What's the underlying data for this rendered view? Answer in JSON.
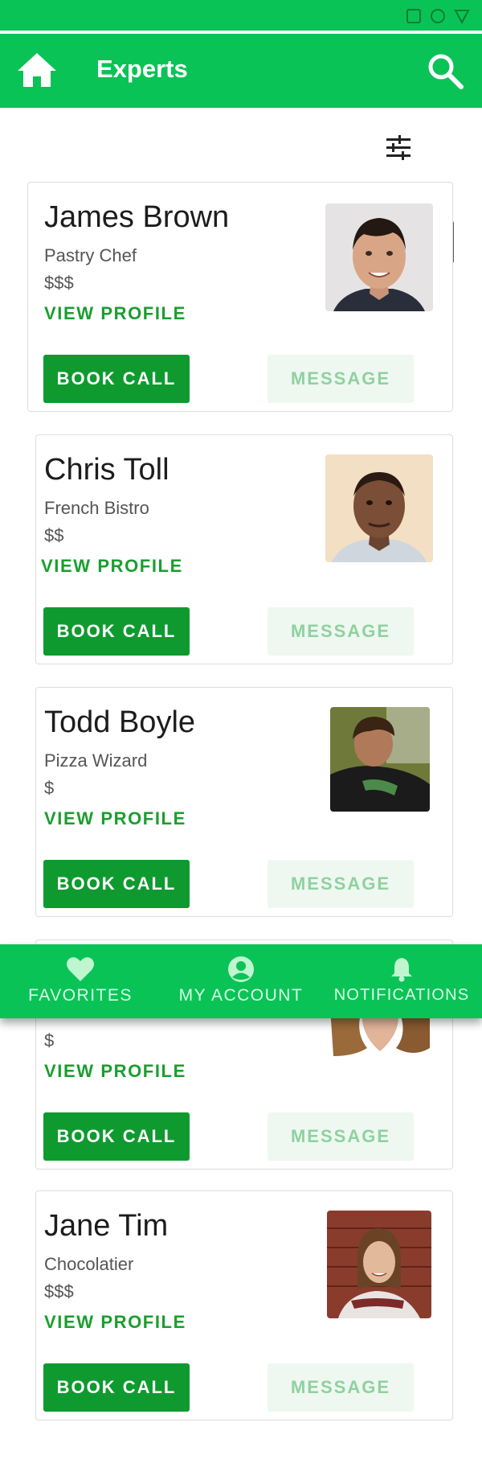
{
  "header": {
    "title": "Experts"
  },
  "icons": {
    "home": "home-icon",
    "search": "search-icon",
    "filter": "filter-sliders-icon",
    "favorites": "heart-icon",
    "account": "account-circle-icon",
    "notifications": "bell-icon"
  },
  "colors": {
    "brand_green": "#0ac356",
    "button_green": "#0f9a2f",
    "link_green": "#1a9e2e",
    "message_bg": "#eef8f0",
    "message_text": "#8fd1a0"
  },
  "experts": [
    {
      "name": "James Brown",
      "role": "Pastry Chef",
      "price": "$$$",
      "view_profile": "VIEW PROFILE",
      "book_call": "BOOK CALL",
      "message": "MESSAGE"
    },
    {
      "name": "Chris Toll",
      "role": "French Bistro",
      "price": "$$",
      "view_profile": "VIEW PROFILE",
      "book_call": "BOOK CALL",
      "message": "MESSAGE"
    },
    {
      "name": "Todd Boyle",
      "role": "Pizza Wizard",
      "price": "$",
      "view_profile": "VIEW PROFILE",
      "book_call": "BOOK CALL",
      "message": "MESSAGE"
    },
    {
      "price": "$",
      "view_profile": "VIEW PROFILE",
      "book_call": "BOOK CALL",
      "message": "MESSAGE"
    },
    {
      "name": "Jane Tim",
      "role": "Chocolatier",
      "price": "$$$",
      "view_profile": "VIEW PROFILE",
      "book_call": "BOOK CALL",
      "message": "MESSAGE"
    }
  ],
  "bottom_nav": {
    "favorites": "FAVORITES",
    "account": "MY ACCOUNT",
    "notifications": "NOTIFICATIONS"
  }
}
